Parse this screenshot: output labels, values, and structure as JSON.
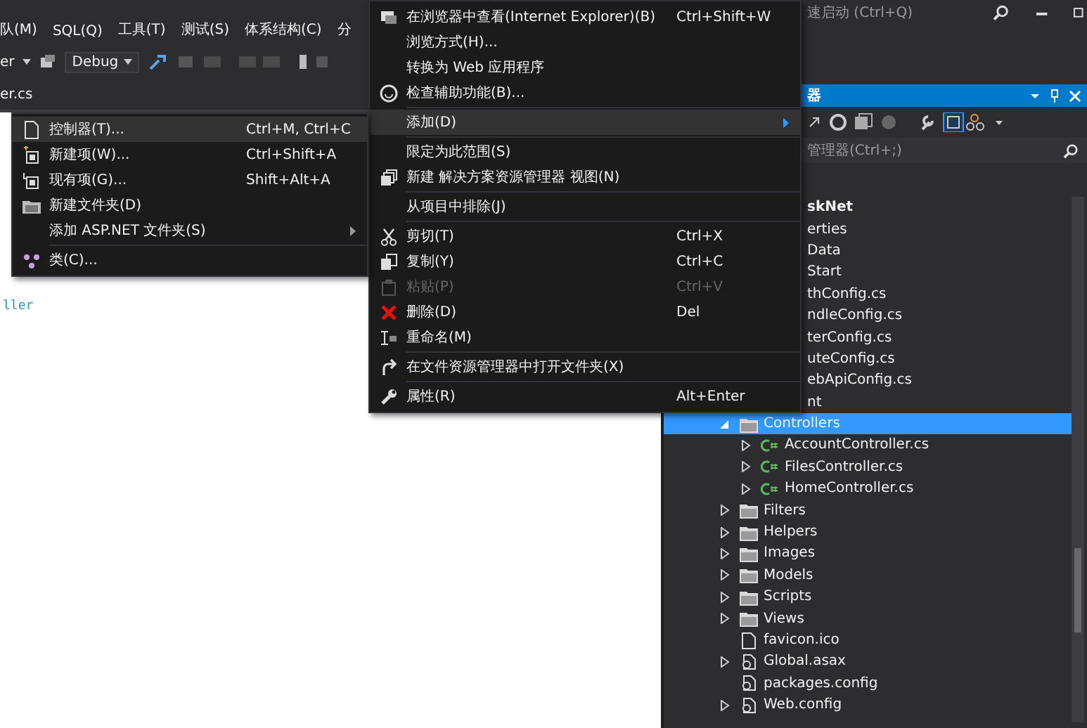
{
  "menubar": {
    "items": [
      "队(M)",
      "SQL(Q)",
      "工具(T)",
      "测试(S)",
      "体系结构(C)",
      "分"
    ]
  },
  "toolbar": {
    "platform": "er",
    "configuration": "Debug"
  },
  "editor": {
    "tab": "er.cs",
    "code": "ller"
  },
  "quick_launch": {
    "placeholder": "速启动 (Ctrl+Q)"
  },
  "solution_explorer": {
    "title": "器",
    "search": {
      "placeholder": "管理器(Ctrl+;)"
    },
    "tree": [
      {
        "label": "skNet",
        "kind": "partial",
        "children": [
          {
            "label": "erties",
            "kind": "partial"
          },
          {
            "label": "Data",
            "kind": "partial"
          },
          {
            "label": "Start",
            "kind": "partial",
            "children": [
              {
                "label": "thConfig.cs",
                "kind": "partial"
              },
              {
                "label": "ndleConfig.cs",
                "kind": "partial"
              },
              {
                "label": "terConfig.cs",
                "kind": "partial"
              },
              {
                "label": "uteConfig.cs",
                "kind": "partial"
              },
              {
                "label": "ebApiConfig.cs",
                "kind": "partial"
              }
            ]
          },
          {
            "label": "nt",
            "kind": "partial"
          },
          {
            "label": "Controllers",
            "kind": "folder",
            "expanded": true,
            "selected": true,
            "children": [
              {
                "label": "AccountController.cs",
                "kind": "cs",
                "expanded": false,
                "selected": false
              },
              {
                "label": "FilesController.cs",
                "kind": "cs",
                "expanded": false,
                "selected": false
              },
              {
                "label": "HomeController.cs",
                "kind": "cs",
                "expanded": false,
                "selected": false
              }
            ]
          },
          {
            "label": "Filters",
            "kind": "folder",
            "expanded": false,
            "selected": false
          },
          {
            "label": "Helpers",
            "kind": "folder",
            "expanded": false,
            "selected": false
          },
          {
            "label": "Images",
            "kind": "folder",
            "expanded": false,
            "selected": false
          },
          {
            "label": "Models",
            "kind": "folder",
            "expanded": false,
            "selected": false
          },
          {
            "label": "Scripts",
            "kind": "folder",
            "expanded": false,
            "selected": false
          },
          {
            "label": "Views",
            "kind": "folder",
            "expanded": false,
            "selected": false
          },
          {
            "label": "favicon.ico",
            "kind": "file",
            "selected": false
          },
          {
            "label": "Global.asax",
            "kind": "config",
            "expanded": false,
            "selected": false
          },
          {
            "label": "packages.config",
            "kind": "config",
            "selected": false
          },
          {
            "label": "Web.config",
            "kind": "config",
            "expanded": false,
            "selected": false
          }
        ]
      }
    ]
  },
  "context_menu": {
    "items": [
      {
        "kind": "item",
        "label": "在浏览器中查看(Internet Explorer)(B)",
        "shortcut": "Ctrl+Shift+W",
        "selected": false,
        "disabled": false
      },
      {
        "kind": "item",
        "label": "浏览方式(H)...",
        "selected": false,
        "disabled": false
      },
      {
        "kind": "item",
        "label": "转换为 Web 应用程序",
        "selected": false,
        "disabled": false
      },
      {
        "kind": "item",
        "label": "检查辅助功能(B)...",
        "selected": false,
        "disabled": false
      },
      {
        "kind": "separator"
      },
      {
        "kind": "item",
        "label": "添加(D)",
        "submenu": true,
        "selected": true,
        "disabled": false
      },
      {
        "kind": "separator"
      },
      {
        "kind": "item",
        "label": "限定为此范围(S)",
        "selected": false,
        "disabled": false
      },
      {
        "kind": "item",
        "label": "新建 解决方案资源管理器 视图(N)",
        "selected": false,
        "disabled": false
      },
      {
        "kind": "separator"
      },
      {
        "kind": "item",
        "label": "从项目中排除(J)",
        "selected": false,
        "disabled": false
      },
      {
        "kind": "separator"
      },
      {
        "kind": "item",
        "label": "剪切(T)",
        "shortcut": "Ctrl+X",
        "selected": false,
        "disabled": false
      },
      {
        "kind": "item",
        "label": "复制(Y)",
        "shortcut": "Ctrl+C",
        "selected": false,
        "disabled": false
      },
      {
        "kind": "item",
        "label": "粘贴(P)",
        "shortcut": "Ctrl+V",
        "selected": false,
        "disabled": true
      },
      {
        "kind": "item",
        "label": "删除(D)",
        "shortcut": "Del",
        "selected": false,
        "disabled": false
      },
      {
        "kind": "item",
        "label": "重命名(M)",
        "selected": false,
        "disabled": false
      },
      {
        "kind": "separator"
      },
      {
        "kind": "item",
        "label": "在文件资源管理器中打开文件夹(X)",
        "selected": false,
        "disabled": false
      },
      {
        "kind": "separator"
      },
      {
        "kind": "item",
        "label": "属性(R)",
        "shortcut": "Alt+Enter",
        "selected": false,
        "disabled": false
      }
    ]
  },
  "submenu": {
    "items": [
      {
        "kind": "item",
        "label": "控制器(T)...",
        "shortcut": "Ctrl+M, Ctrl+C",
        "selected": true,
        "disabled": false
      },
      {
        "kind": "item",
        "label": "新建项(W)...",
        "shortcut": "Ctrl+Shift+A",
        "selected": false,
        "disabled": false
      },
      {
        "kind": "item",
        "label": "现有项(G)...",
        "shortcut": "Shift+Alt+A",
        "selected": false,
        "disabled": false
      },
      {
        "kind": "item",
        "label": "新建文件夹(D)",
        "selected": false,
        "disabled": false
      },
      {
        "kind": "item",
        "label": "添加 ASP.NET 文件夹(S)",
        "submenu": true,
        "selected": false,
        "disabled": false
      },
      {
        "kind": "separator"
      },
      {
        "kind": "item",
        "label": "类(C)...",
        "selected": false,
        "disabled": false
      }
    ]
  }
}
